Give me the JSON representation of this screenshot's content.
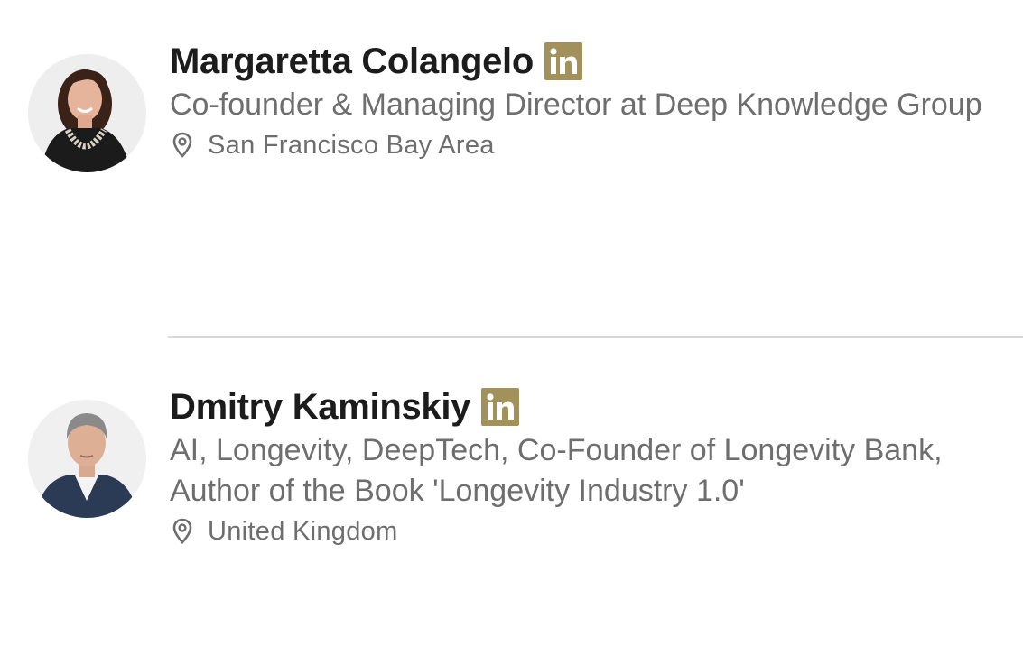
{
  "people": [
    {
      "name": "Margaretta Colangelo",
      "headline": "Co-founder & Managing Director at Deep Knowledge Group",
      "location": "San Francisco Bay Area",
      "badge_icon": "linkedin-icon",
      "location_icon": "location-pin-icon"
    },
    {
      "name": "Dmitry Kaminskiy",
      "headline": "AI, Longevity, DeepTech, Co-Founder of Longevity Bank, Author of the Book 'Longevity Industry 1.0'",
      "location": "United Kingdom",
      "badge_icon": "linkedin-icon",
      "location_icon": "location-pin-icon"
    }
  ],
  "colors": {
    "linkedin_badge": "#a2915a",
    "name_text": "#1c1c1c",
    "secondary_text": "#6e6e6e",
    "divider": "#d9d9d9"
  }
}
